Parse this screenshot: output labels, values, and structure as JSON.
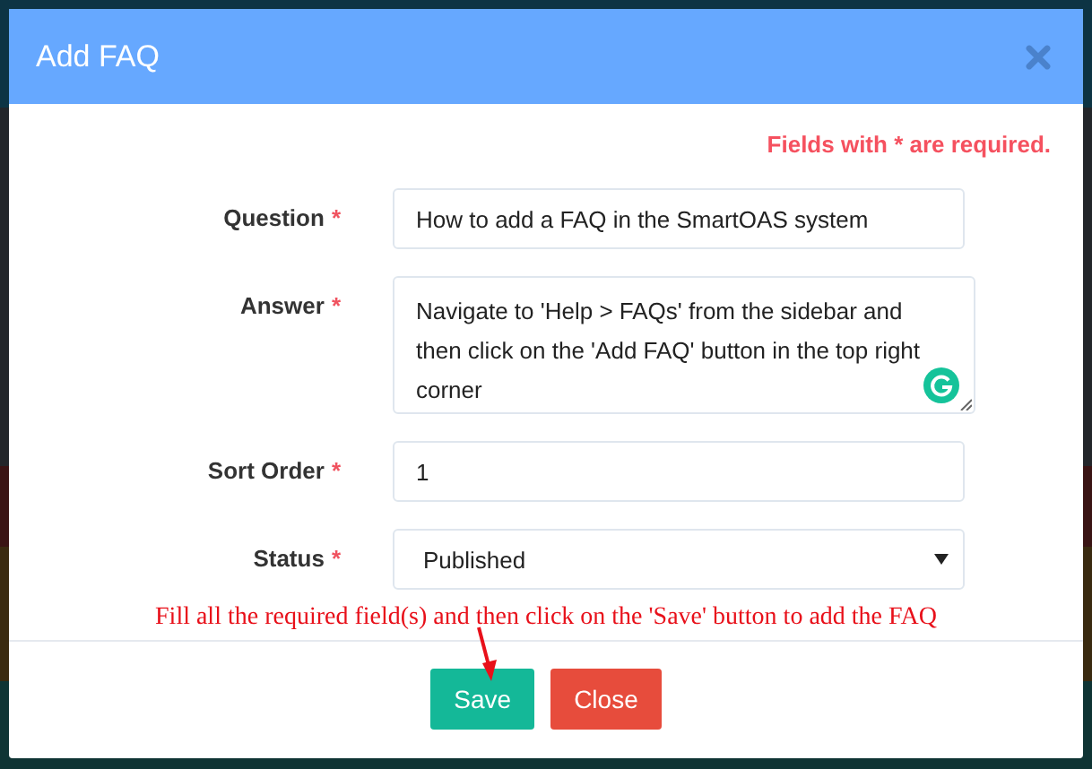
{
  "dialog": {
    "title": "Add FAQ",
    "required_note": "Fields with * are required."
  },
  "fields": [
    {
      "kind": "text",
      "label": "Question",
      "required_mark": "*",
      "value": "How to add a FAQ in the SmartOAS system"
    },
    {
      "kind": "textarea",
      "label": "Answer",
      "required_mark": "*",
      "value": "Navigate to 'Help > FAQs' from the sidebar and then click on the 'Add FAQ' button in the top right corner"
    },
    {
      "kind": "text",
      "label": "Sort Order",
      "required_mark": "*",
      "value": "1"
    },
    {
      "kind": "select",
      "label": "Status",
      "required_mark": "*",
      "value": "Published"
    }
  ],
  "annotation": "Fill all the required field(s) and then click on the 'Save' button to add the FAQ",
  "buttons": [
    {
      "label": "Save",
      "kind": "primary"
    },
    {
      "label": "Close",
      "kind": "danger"
    }
  ]
}
